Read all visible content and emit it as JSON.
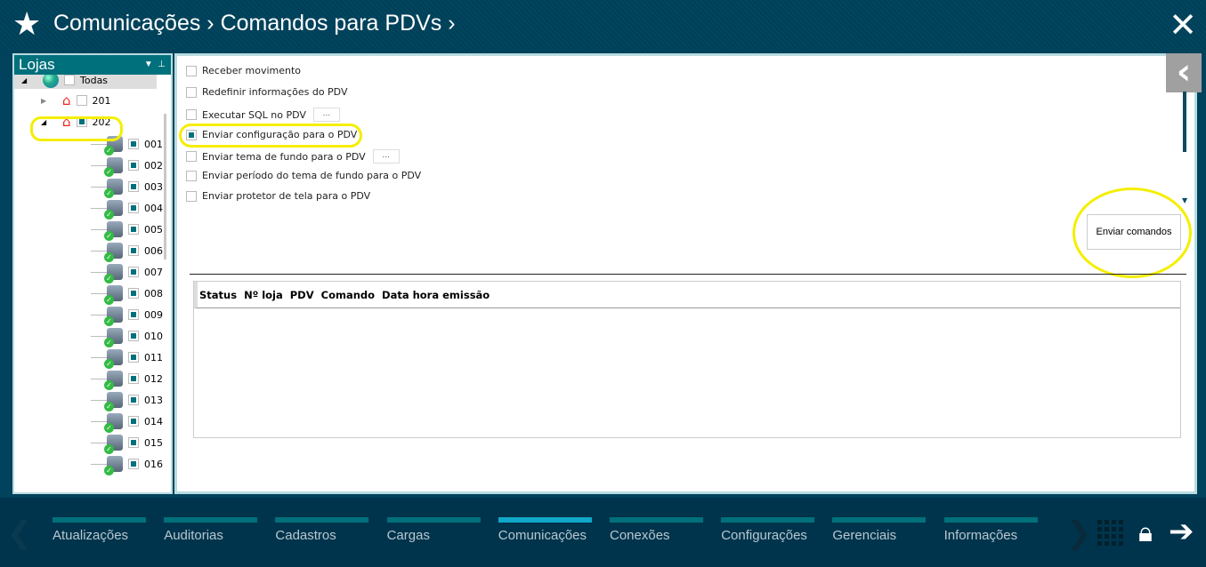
{
  "header": {
    "title": "Comunicações › Comandos para PDVs ›",
    "star_icon": "star-icon",
    "close_icon": "close-icon"
  },
  "left_panel": {
    "title": "Lojas",
    "tree": [
      {
        "label": "Todas",
        "level": 0,
        "icon": "globe-icon",
        "checked": false,
        "expander": "expanded"
      },
      {
        "label": "201",
        "level": 1,
        "icon": "store-icon",
        "checked": false,
        "expander": "collapsed"
      },
      {
        "label": "202",
        "level": 1,
        "icon": "store-icon",
        "checked": true,
        "expander": "expanded"
      },
      {
        "label": "001",
        "level": 2,
        "checked": true
      },
      {
        "label": "002",
        "level": 2,
        "checked": true
      },
      {
        "label": "003",
        "level": 2,
        "checked": true
      },
      {
        "label": "004",
        "level": 2,
        "checked": true
      },
      {
        "label": "005",
        "level": 2,
        "checked": true
      },
      {
        "label": "006",
        "level": 2,
        "checked": true
      },
      {
        "label": "007",
        "level": 2,
        "checked": true
      },
      {
        "label": "008",
        "level": 2,
        "checked": true
      },
      {
        "label": "009",
        "level": 2,
        "checked": true
      },
      {
        "label": "010",
        "level": 2,
        "checked": true
      },
      {
        "label": "011",
        "level": 2,
        "checked": true
      },
      {
        "label": "012",
        "level": 2,
        "checked": true
      },
      {
        "label": "013",
        "level": 2,
        "checked": true
      },
      {
        "label": "014",
        "level": 2,
        "checked": true
      },
      {
        "label": "015",
        "level": 2,
        "checked": true
      },
      {
        "label": "016",
        "level": 2,
        "checked": true
      }
    ]
  },
  "options": [
    {
      "label": "Receber movimento",
      "checked": false
    },
    {
      "label": "Redefinir informações do PDV",
      "checked": false
    },
    {
      "label": "Executar SQL no PDV",
      "checked": false,
      "dots": "..."
    },
    {
      "label": "Enviar configuração para o PDV",
      "checked": true
    },
    {
      "label": "Enviar tema de fundo para o PDV",
      "checked": false,
      "dots": "..."
    },
    {
      "label": "Enviar período do tema de fundo para o PDV",
      "checked": false
    },
    {
      "label": "Enviar protetor de tela para o PDV",
      "checked": false
    }
  ],
  "send_button": "Enviar comandos",
  "grid_columns": [
    "Status",
    "Nº loja",
    "PDV",
    "Comando",
    "Data hora emissão"
  ],
  "nav": {
    "items": [
      "Atualizações",
      "Auditorias",
      "Cadastros",
      "Cargas",
      "Comunicações",
      "Conexões",
      "Configurações",
      "Gerenciais",
      "Informações"
    ],
    "active": "Comunicações"
  },
  "colors": {
    "accent": "#00707c",
    "highlight": "#f5ee00",
    "header": "#01425c"
  }
}
